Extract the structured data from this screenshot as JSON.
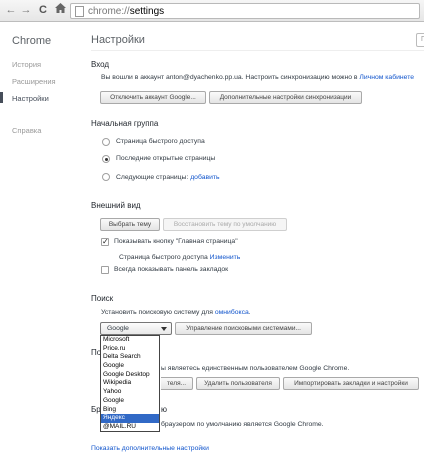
{
  "browser": {
    "url_scheme": "chrome://",
    "url_path": "settings",
    "back_icon": "back-arrow",
    "forward_icon": "forward-arrow",
    "reload_icon": "reload",
    "home_icon": "home"
  },
  "sidebar": {
    "brand": "Chrome",
    "items": [
      {
        "label": "История"
      },
      {
        "label": "Расширения"
      },
      {
        "label": "Настройки"
      },
      {
        "label": "Справка"
      }
    ]
  },
  "header": {
    "title": "Настройки",
    "search_stub": "Г"
  },
  "signin": {
    "title": "Вход",
    "text": "Вы вошли в аккаунт anton@dyachenko.pp.ua. Настроить синхронизацию можно в",
    "link": "Личном кабинете",
    "disconnect_button": "Отключить аккаунт Google...",
    "advanced_sync_button": "Дополнительные настройки синхронизации"
  },
  "startup": {
    "title": "Начальная группа",
    "options": [
      {
        "label": "Страница быстрого доступа",
        "checked": false
      },
      {
        "label": "Последние открытые страницы",
        "checked": true
      },
      {
        "label": "Следующие страницы:",
        "checked": false
      }
    ],
    "add_link": "добавить"
  },
  "appearance": {
    "title": "Внешний вид",
    "choose_theme_button": "Выбрать тему",
    "reset_theme_button": "Восстановить тему по умолчанию",
    "home_button_label": "Показывать кнопку \"Главная страница\"",
    "home_page_text": "Страница быстрого доступа",
    "change_link": "Изменить",
    "bookmarks_bar_label": "Всегда показывать панель закладок"
  },
  "search": {
    "title": "Поиск",
    "text": "Установить поисковую систему для",
    "omnibox_link": "омнибокса",
    "selected_engine": "Google",
    "manage_button": "Управление поисковыми системами...",
    "engines": [
      "Microsoft",
      "Price.ru",
      "Delta Search",
      "Google",
      "Google Desktop",
      "Wikipedia",
      "Yahoo",
      "Google",
      "Bing",
      "Яндекс",
      "@MAIL.RU"
    ],
    "highlighted_index": 9
  },
  "users": {
    "title_visible": "По",
    "text_visible": "ы являетесь единственным пользователем Google Chrome.",
    "add_button_visible": "теля...",
    "delete_button": "Удалить пользователя",
    "import_button": "Импортировать закладки и настройки"
  },
  "default_browser": {
    "title_visible_left": "Бр",
    "title_visible_right": "ю",
    "text_visible": "браузером по умолчанию является Google Chrome."
  },
  "footer": {
    "advanced_link": "Показать дополнительные настройки"
  }
}
